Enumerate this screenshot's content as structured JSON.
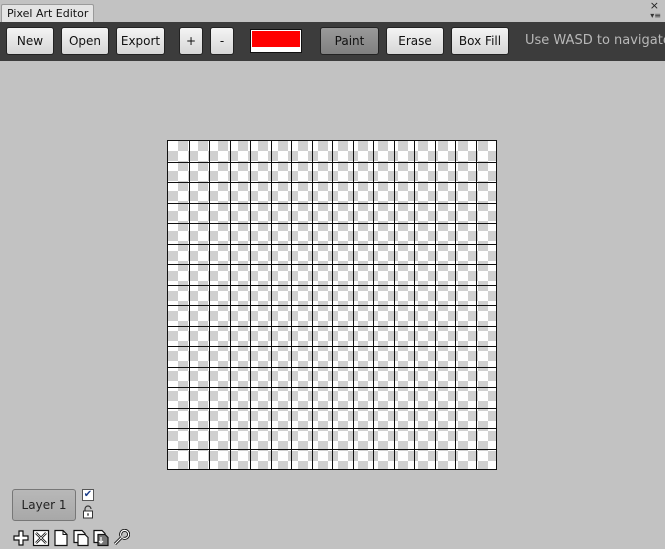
{
  "window": {
    "tab_title": "Pixel Art Editor",
    "close_glyph": "×",
    "menu_glyph": "▾≡"
  },
  "toolbar": {
    "new_label": "New",
    "open_label": "Open",
    "export_label": "Export",
    "zoom_in_label": "+",
    "zoom_out_label": "-",
    "current_color": "#ff0000",
    "paint_label": "Paint",
    "erase_label": "Erase",
    "box_fill_label": "Box Fill",
    "hint": "Use WASD to navigate"
  },
  "canvas": {
    "columns": 16,
    "rows": 16,
    "checker_light": "#ffffff",
    "checker_dark": "#d0d0d0",
    "grid_color": "#111111"
  },
  "layers": {
    "items": [
      {
        "label": "Layer 1",
        "visible": true,
        "locked": false
      }
    ]
  },
  "layer_tools": [
    {
      "icon": "add-layer-icon"
    },
    {
      "icon": "delete-layer-icon"
    },
    {
      "icon": "new-page-icon"
    },
    {
      "icon": "duplicate-layer-icon"
    },
    {
      "icon": "merge-layer-icon"
    },
    {
      "icon": "wrench-icon"
    }
  ]
}
